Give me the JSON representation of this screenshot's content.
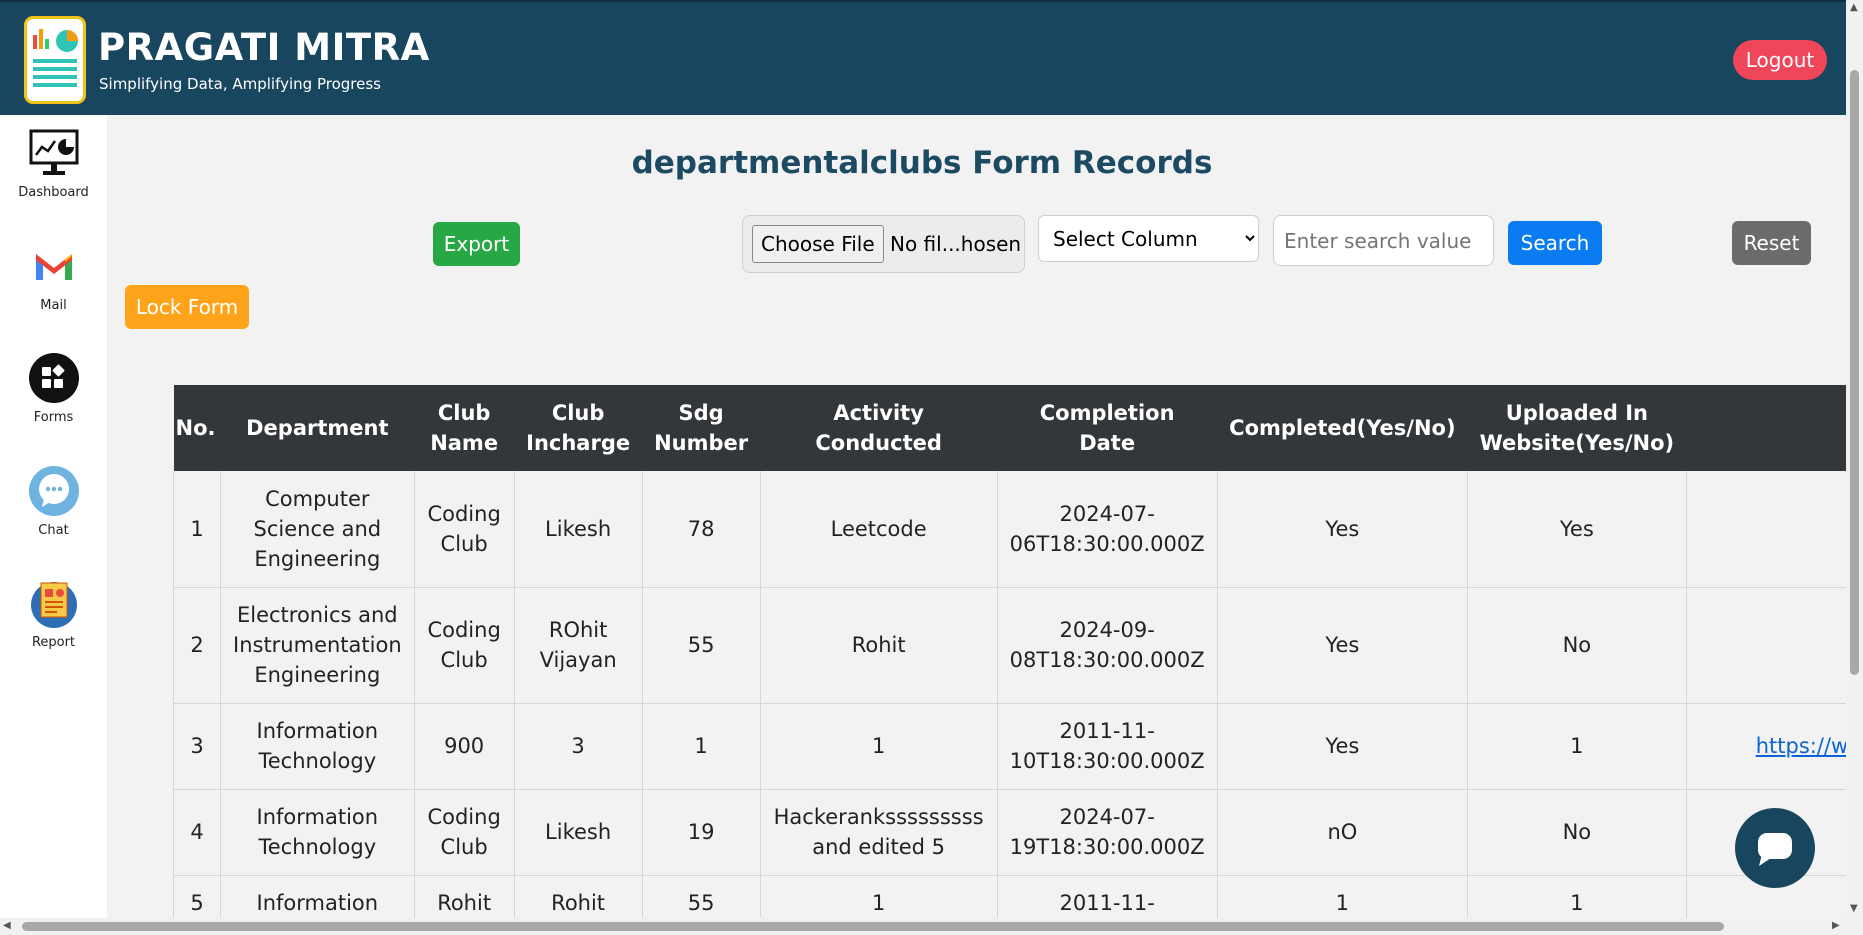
{
  "header": {
    "title": "PRAGATI MITRA",
    "subtitle": "Simplifying Data, Amplifying Progress",
    "logout_label": "Logout",
    "background": "#18465f",
    "logout_color": "#f0465a"
  },
  "sidebar": {
    "items": [
      {
        "label": "Dashboard",
        "icon": "dashboard-monitor-icon"
      },
      {
        "label": "Mail",
        "icon": "mail-icon"
      },
      {
        "label": "Forms",
        "icon": "forms-icon"
      },
      {
        "label": "Chat",
        "icon": "chat-icon"
      },
      {
        "label": "Report",
        "icon": "report-icon"
      }
    ]
  },
  "main": {
    "title": "departmentalclubs Form Records",
    "export_label": "Export",
    "file_button_label": "Choose File",
    "file_status": "No fil...hosen",
    "select_value": "Select Column",
    "search_placeholder": "Enter search value",
    "search_label": "Search",
    "reset_label": "Reset",
    "lock_label": "Lock Form"
  },
  "table": {
    "headers": [
      "No.",
      "Department",
      "Club Name",
      "Club Incharge",
      "Sdg Number",
      "Activity Conducted",
      "Completion Date",
      "Completed(Yes/No)",
      "Uploaded In Website(Yes/No)",
      ""
    ],
    "rows": [
      [
        "1",
        "Computer Science and Engineering",
        "Coding Club",
        "Likesh",
        "78",
        "Leetcode",
        "2024-07-06T18:30:00.000Z",
        "Yes",
        "Yes",
        ""
      ],
      [
        "2",
        "Electronics and Instrumentation Engineering",
        "Coding Club",
        "ROhit Vijayan",
        "55",
        "Rohit",
        "2024-09-08T18:30:00.000Z",
        "Yes",
        "No",
        ""
      ],
      [
        "3",
        "Information Technology",
        "900",
        "3",
        "1",
        "1",
        "2011-11-10T18:30:00.000Z",
        "Yes",
        "1",
        "https://www.yout"
      ],
      [
        "4",
        "Information Technology",
        "Coding Club",
        "Likesh",
        "19",
        "Hackeranksssssssss and edited 5",
        "2024-07-19T18:30:00.000Z",
        "nO",
        "No",
        ""
      ],
      [
        "5",
        "Information",
        "Rohit",
        "Rohit",
        "55",
        "1",
        "2011-11-",
        "1",
        "1",
        ""
      ]
    ]
  }
}
